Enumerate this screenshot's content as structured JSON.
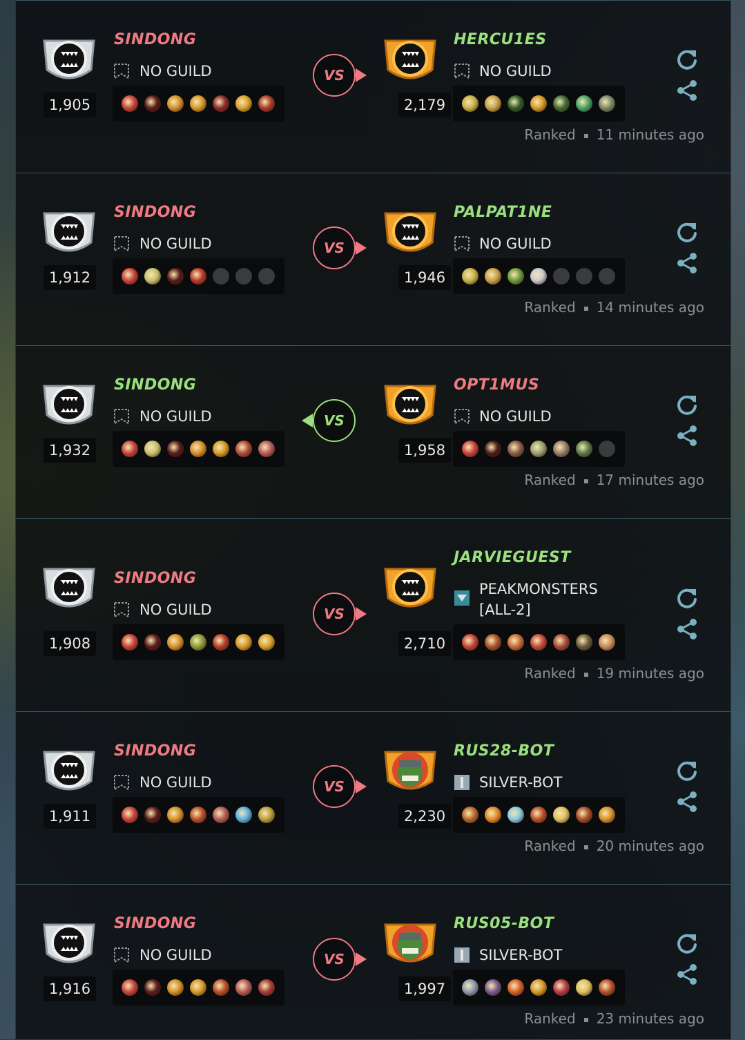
{
  "battles": [
    {
      "player": {
        "name": "SINDONG",
        "result": "lose",
        "rating": "1,905",
        "guild": "NO GUILD",
        "shield": "silver",
        "cards": [
          "#c9433b",
          "#5a1a1a",
          "#d6902a",
          "#d69a2a",
          "#8a2a2a",
          "#d9a12c",
          "#a83a2a"
        ]
      },
      "opponent": {
        "name": "HERCU1ES",
        "result": "win",
        "rating": "2,179",
        "guild": "NO GUILD",
        "shield": "gold",
        "guild_icon": "empty",
        "cards": [
          "#c7b247",
          "#c9a14a",
          "#2f5a2a",
          "#d69a2a",
          "#3f6a35",
          "#49a36a",
          "#7a8a6a"
        ]
      },
      "vs": "VS",
      "vs_direction": "right",
      "type": "Ranked",
      "time": "11 minutes ago"
    },
    {
      "player": {
        "name": "SINDONG",
        "result": "lose",
        "rating": "1,912",
        "guild": "NO GUILD",
        "shield": "silver",
        "cards": [
          "#c9433b",
          "#c8c070",
          "#5a1a1a",
          "#b83a2a",
          "empty",
          "empty",
          "empty"
        ]
      },
      "opponent": {
        "name": "PALPAT1NE",
        "result": "win",
        "rating": "1,946",
        "guild": "NO GUILD",
        "shield": "gold",
        "guild_icon": "empty",
        "cards": [
          "#c7b247",
          "#c9a14a",
          "#6a9a3a",
          "#c8c8d0",
          "empty",
          "empty",
          "empty"
        ]
      },
      "vs": "VS",
      "vs_direction": "right",
      "type": "Ranked",
      "time": "14 minutes ago"
    },
    {
      "player": {
        "name": "SINDONG",
        "result": "win",
        "rating": "1,932",
        "guild": "NO GUILD",
        "shield": "silver",
        "cards": [
          "#c9433b",
          "#c8c070",
          "#5a1a1a",
          "#d6902a",
          "#d69a2a",
          "#b04a3a",
          "#b85a5a"
        ]
      },
      "opponent": {
        "name": "OPT1MUS",
        "result": "lose",
        "rating": "1,958",
        "guild": "NO GUILD",
        "shield": "gold",
        "guild_icon": "empty",
        "cards": [
          "#c9433b",
          "#4a1a1a",
          "#8a5a4a",
          "#9aa070",
          "#9a7a6a",
          "#5a7a4a",
          "empty"
        ]
      },
      "vs": "VS",
      "vs_direction": "left",
      "type": "Ranked",
      "time": "17 minutes ago"
    },
    {
      "player": {
        "name": "SINDONG",
        "result": "lose",
        "rating": "1,908",
        "guild": "NO GUILD",
        "shield": "silver",
        "cards": [
          "#c9433b",
          "#5a1a1a",
          "#d6902a",
          "#8a9a3a",
          "#b83a2a",
          "#d69a2a",
          "#d9a12c"
        ]
      },
      "opponent": {
        "name": "JARVIEGUEST",
        "result": "win",
        "rating": "2,710",
        "guild": "PEAKMONSTERS\n[ALL-2]",
        "guild_line1": "PEAKMONSTERS",
        "guild_line2": "[ALL-2]",
        "shield": "gold",
        "guild_icon": "banner",
        "cards": [
          "#c9433b",
          "#a8522a",
          "#c86a3a",
          "#c24a3a",
          "#a84a3a",
          "#6a5a3a",
          "#c98a5a"
        ]
      },
      "vs": "VS",
      "vs_direction": "right",
      "type": "Ranked",
      "time": "19 minutes ago"
    },
    {
      "player": {
        "name": "SINDONG",
        "result": "lose",
        "rating": "1,911",
        "guild": "NO GUILD",
        "shield": "silver",
        "cards": [
          "#c9433b",
          "#5a1a1a",
          "#d6902a",
          "#b8502a",
          "#b85a5a",
          "#5ab0e0",
          "#b8a03a"
        ]
      },
      "opponent": {
        "name": "RUS28-BOT",
        "result": "win",
        "rating": "2,230",
        "guild": "SILVER-BOT",
        "shield": "avatar",
        "guild_icon": "silver",
        "cards": [
          "#b86a2a",
          "#e08a2a",
          "#8ac8e0",
          "#b8502a",
          "#e0c060",
          "#a84a2a",
          "#d6902a"
        ]
      },
      "vs": "VS",
      "vs_direction": "right",
      "type": "Ranked",
      "time": "20 minutes ago"
    },
    {
      "player": {
        "name": "SINDONG",
        "result": "lose",
        "rating": "1,916",
        "guild": "NO GUILD",
        "shield": "silver",
        "cards": [
          "#c9433b",
          "#5a1a1a",
          "#d6902a",
          "#d69a2a",
          "#b8502a",
          "#b85a5a",
          "#a83a3a"
        ]
      },
      "opponent": {
        "name": "RUS05-BOT",
        "result": "win",
        "rating": "1,997",
        "guild": "SILVER-BOT",
        "shield": "avatar",
        "guild_icon": "silver",
        "cards": [
          "#8a9ab0",
          "#7a5a8a",
          "#d6602a",
          "#d69a2a",
          "#b83a4a",
          "#e0c060",
          "#b8502a"
        ]
      },
      "vs": "VS",
      "vs_direction": "right",
      "type": "Ranked",
      "time": "23 minutes ago"
    }
  ],
  "colors": {
    "win": "#9ae07e",
    "lose": "#ee7a82",
    "accent": "#7ab0c0",
    "meta": "#8a8f93"
  },
  "icons": {
    "refresh": "refresh-icon",
    "share": "share-icon",
    "guild_empty": "empty-banner-icon",
    "shield": "shield-icon"
  }
}
